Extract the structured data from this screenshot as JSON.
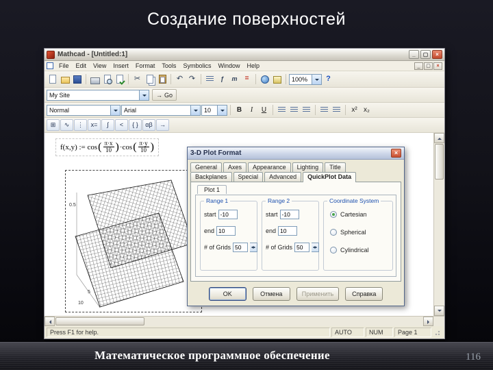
{
  "slide": {
    "title": "Создание поверхностей",
    "footer": "Математическое программное обеспечение",
    "page_number": "116"
  },
  "icons": {
    "minimize": "_",
    "maximize": "▢",
    "close": "×",
    "help": "?",
    "cut": "✂",
    "undo": "↶",
    "redo": "↷",
    "function": "ƒ",
    "unit": "m",
    "calculate": "=",
    "go": "→"
  },
  "window": {
    "title": "Mathcad - [Untitled:1]",
    "menus": [
      "File",
      "Edit",
      "View",
      "Insert",
      "Format",
      "Tools",
      "Symbolics",
      "Window",
      "Help"
    ],
    "toolbar": {
      "zoom": "100%"
    },
    "mysite": {
      "value": "My Site",
      "go_label": "Go"
    },
    "formatting": {
      "style": "Normal",
      "font": "Arial",
      "size": "10",
      "bold": "B",
      "italic": "I",
      "underline": "U",
      "superscript": "x²",
      "subscript": "x₂"
    },
    "mathbar": {
      "glyphs": [
        "⊞",
        "∿",
        "⋮",
        "x=",
        "∫",
        "<",
        "{ }",
        "αβ",
        "→"
      ]
    },
    "worksheet": {
      "formula": {
        "lhs": "f(x,y) := cos",
        "lp": "(",
        "rp": ")",
        "mid": "·cos",
        "num1": "π·x",
        "den1": "10",
        "num2": "π·y",
        "den2": "10"
      },
      "plot_labels": {
        "z1": "0.5",
        "x_max": "10",
        "y_mid": "5",
        "y_max": "10"
      }
    },
    "statusbar": {
      "hint": "Press F1 for help.",
      "auto": "AUTO",
      "num": "NUM",
      "page": "Page 1"
    }
  },
  "dialog": {
    "title": "3-D Plot Format",
    "tabs_row1": [
      "General",
      "Axes",
      "Appearance",
      "Lighting",
      "Title"
    ],
    "tabs_row2": [
      "Backplanes",
      "Special",
      "Advanced",
      "QuickPlot Data"
    ],
    "plot_tab": "Plot 1",
    "range1": {
      "caption": "Range 1",
      "start_label": "start",
      "start": "-10",
      "end_label": "end",
      "end": "10",
      "grids_label": "# of Grids",
      "grids": "50"
    },
    "range2": {
      "caption": "Range 2",
      "start_label": "start",
      "start": "-10",
      "end_label": "end",
      "end": "10",
      "grids_label": "# of Grids",
      "grids": "50"
    },
    "coordinate_system": {
      "caption": "Coordinate System",
      "options": [
        "Cartesian",
        "Spherical",
        "Cylindrical"
      ],
      "selected": "Cartesian"
    },
    "buttons": {
      "ok": "OK",
      "cancel": "Отмена",
      "apply": "Применить",
      "help": "Справка"
    }
  }
}
